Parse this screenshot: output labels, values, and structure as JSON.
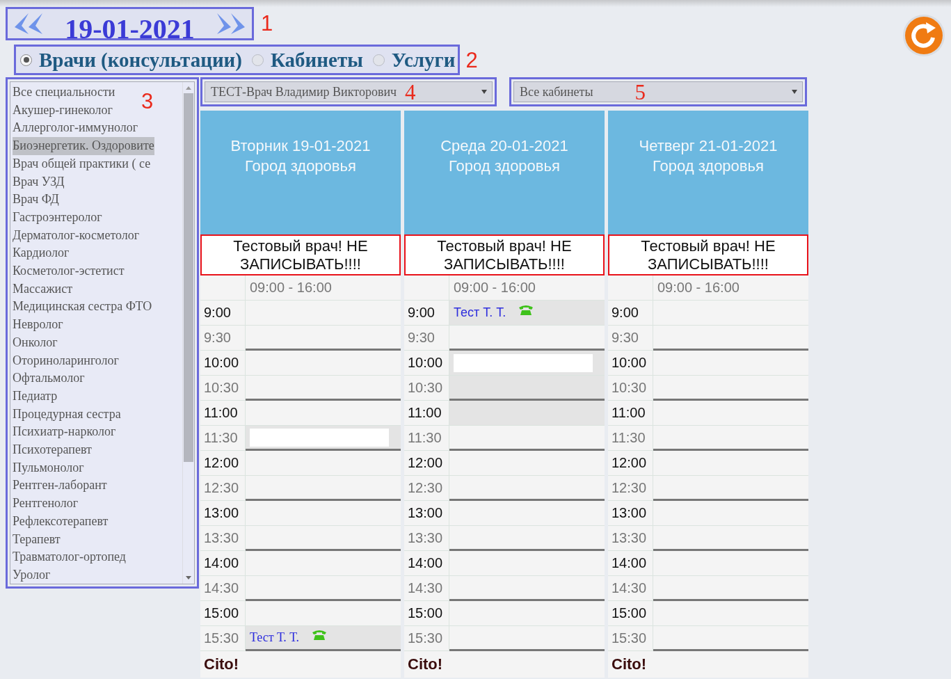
{
  "date_nav": {
    "date": "19-01-2021",
    "annotation": "1"
  },
  "view_modes": {
    "annotation": "2",
    "options": [
      {
        "label": "Врачи (консультации)",
        "selected": true
      },
      {
        "label": "Кабинеты",
        "selected": false
      },
      {
        "label": "Услуги",
        "selected": false
      }
    ]
  },
  "specialties": {
    "annotation": "3",
    "items": [
      {
        "label": "Все специальности",
        "selected": false
      },
      {
        "label": "Акушер-гинеколог",
        "selected": false
      },
      {
        "label": "Аллерголог-иммунолог",
        "selected": false
      },
      {
        "label": "Биоэнергетик. Оздоровите",
        "selected": true
      },
      {
        "label": "Врач общей практики ( се",
        "selected": false
      },
      {
        "label": "Врач УЗД",
        "selected": false
      },
      {
        "label": "Врач ФД",
        "selected": false
      },
      {
        "label": "Гастроэнтеролог",
        "selected": false
      },
      {
        "label": "Дерматолог-косметолог",
        "selected": false
      },
      {
        "label": "Кардиолог",
        "selected": false
      },
      {
        "label": "Косметолог-эстетист",
        "selected": false
      },
      {
        "label": "Массажист",
        "selected": false
      },
      {
        "label": "Медицинская сестра ФТО",
        "selected": false
      },
      {
        "label": "Невролог",
        "selected": false
      },
      {
        "label": "Онколог",
        "selected": false
      },
      {
        "label": "Оториноларинголог",
        "selected": false
      },
      {
        "label": "Офтальмолог",
        "selected": false
      },
      {
        "label": "Педиатр",
        "selected": false
      },
      {
        "label": "Процедурная сестра",
        "selected": false
      },
      {
        "label": "Психиатр-нарколог",
        "selected": false
      },
      {
        "label": "Психотерапевт",
        "selected": false
      },
      {
        "label": "Пульмонолог",
        "selected": false
      },
      {
        "label": "Рентген-лаборант",
        "selected": false
      },
      {
        "label": "Рентгенолог",
        "selected": false
      },
      {
        "label": "Рефлексотерапевт",
        "selected": false
      },
      {
        "label": "Терапевт",
        "selected": false
      },
      {
        "label": "Травматолог-ортопед",
        "selected": false
      },
      {
        "label": "Уролог",
        "selected": false
      }
    ]
  },
  "doctor_select": {
    "value": "ТЕСТ-Врач Владимир Викторович",
    "annotation": "4"
  },
  "room_select": {
    "value": "Все кабинеты",
    "annotation": "5"
  },
  "days": [
    {
      "title": "Вторник 19-01-2021",
      "place": "Город здоровья",
      "note": "Тестовый врач! НЕ ЗАПИСЫВАТЬ!!!!",
      "hours": "09:00 - 16:00",
      "cito": "Cito!",
      "slots": [
        {
          "time": "9:00",
          "major": true,
          "kind": "free"
        },
        {
          "time": "9:30",
          "major": false,
          "kind": "free"
        },
        {
          "time": "10:00",
          "major": true,
          "kind": "free"
        },
        {
          "time": "10:30",
          "major": false,
          "kind": "free"
        },
        {
          "time": "11:00",
          "major": true,
          "kind": "free"
        },
        {
          "time": "11:30",
          "major": false,
          "kind": "hidden"
        },
        {
          "time": "12:00",
          "major": true,
          "kind": "free"
        },
        {
          "time": "12:30",
          "major": false,
          "kind": "free"
        },
        {
          "time": "13:00",
          "major": true,
          "kind": "free"
        },
        {
          "time": "13:30",
          "major": false,
          "kind": "free"
        },
        {
          "time": "14:00",
          "major": true,
          "kind": "free"
        },
        {
          "time": "14:30",
          "major": false,
          "kind": "free"
        },
        {
          "time": "15:00",
          "major": true,
          "kind": "free"
        },
        {
          "time": "15:30",
          "major": false,
          "kind": "patient",
          "patient": "Тест Т. Т.",
          "serif": true
        }
      ]
    },
    {
      "title": "Среда 20-01-2021",
      "place": "Город здоровья",
      "note": "Тестовый врач! НЕ ЗАПИСЫВАТЬ!!!!",
      "hours": "09:00 - 16:00",
      "cito": "Cito!",
      "slots": [
        {
          "time": "9:00",
          "major": true,
          "kind": "patient",
          "patient": "Тест Т. Т.",
          "serif": false
        },
        {
          "time": "9:30",
          "major": false,
          "kind": "free"
        },
        {
          "time": "10:00",
          "major": true,
          "kind": "hidden"
        },
        {
          "time": "10:30",
          "major": false,
          "kind": "busy"
        },
        {
          "time": "11:00",
          "major": true,
          "kind": "busy"
        },
        {
          "time": "11:30",
          "major": false,
          "kind": "free"
        },
        {
          "time": "12:00",
          "major": true,
          "kind": "free"
        },
        {
          "time": "12:30",
          "major": false,
          "kind": "free"
        },
        {
          "time": "13:00",
          "major": true,
          "kind": "free"
        },
        {
          "time": "13:30",
          "major": false,
          "kind": "free"
        },
        {
          "time": "14:00",
          "major": true,
          "kind": "free"
        },
        {
          "time": "14:30",
          "major": false,
          "kind": "free"
        },
        {
          "time": "15:00",
          "major": true,
          "kind": "free"
        },
        {
          "time": "15:30",
          "major": false,
          "kind": "free"
        }
      ]
    },
    {
      "title": "Четверг 21-01-2021",
      "place": "Город здоровья",
      "note": "Тестовый врач! НЕ ЗАПИСЫВАТЬ!!!!",
      "hours": "09:00 - 16:00",
      "cito": "Cito!",
      "slots": [
        {
          "time": "9:00",
          "major": true,
          "kind": "free"
        },
        {
          "time": "9:30",
          "major": false,
          "kind": "free"
        },
        {
          "time": "10:00",
          "major": true,
          "kind": "free"
        },
        {
          "time": "10:30",
          "major": false,
          "kind": "free"
        },
        {
          "time": "11:00",
          "major": true,
          "kind": "free"
        },
        {
          "time": "11:30",
          "major": false,
          "kind": "free"
        },
        {
          "time": "12:00",
          "major": true,
          "kind": "free"
        },
        {
          "time": "12:30",
          "major": false,
          "kind": "free"
        },
        {
          "time": "13:00",
          "major": true,
          "kind": "free"
        },
        {
          "time": "13:30",
          "major": false,
          "kind": "free"
        },
        {
          "time": "14:00",
          "major": true,
          "kind": "free"
        },
        {
          "time": "14:30",
          "major": false,
          "kind": "free"
        },
        {
          "time": "15:00",
          "major": true,
          "kind": "free"
        },
        {
          "time": "15:30",
          "major": false,
          "kind": "free"
        }
      ]
    }
  ]
}
